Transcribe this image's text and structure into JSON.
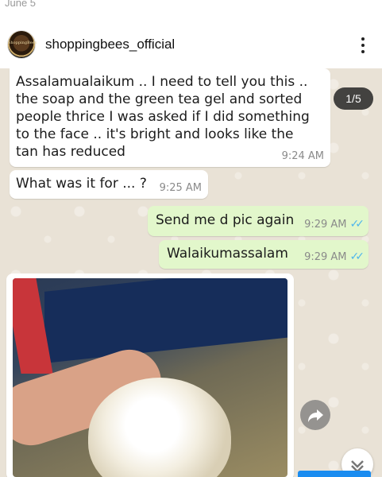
{
  "post": {
    "date": "June 5"
  },
  "header": {
    "username": "shoppingbees_official",
    "avatar_text": "ShoppingBees"
  },
  "carousel": {
    "counter": "1/5"
  },
  "messages": [
    {
      "direction": "incoming",
      "text": "Assalamualaikum .. I need to tell you this .. the soap and the green tea gel and sorted people thrice I was asked if I did something to the face .. it's bright and looks like the tan has reduced",
      "time": "9:24 AM"
    },
    {
      "direction": "incoming",
      "text": "What was it for ... ?",
      "time": "9:25 AM"
    },
    {
      "direction": "outgoing",
      "text": "Send me d pic again",
      "time": "9:29 AM",
      "ticks": "✓✓"
    },
    {
      "direction": "outgoing",
      "text": "Walaikumassalam",
      "time": "9:29 AM",
      "ticks": "✓✓"
    }
  ],
  "icons": [
    "more-vertical-icon",
    "share-forward-icon",
    "chevron-down-icon"
  ],
  "colors": {
    "incoming_bubble": "#ffffff",
    "outgoing_bubble": "#e2f7cb",
    "chat_background": "#e9e2d6",
    "read_ticks": "#4fb6ec",
    "accent": "#1a8cf0"
  }
}
